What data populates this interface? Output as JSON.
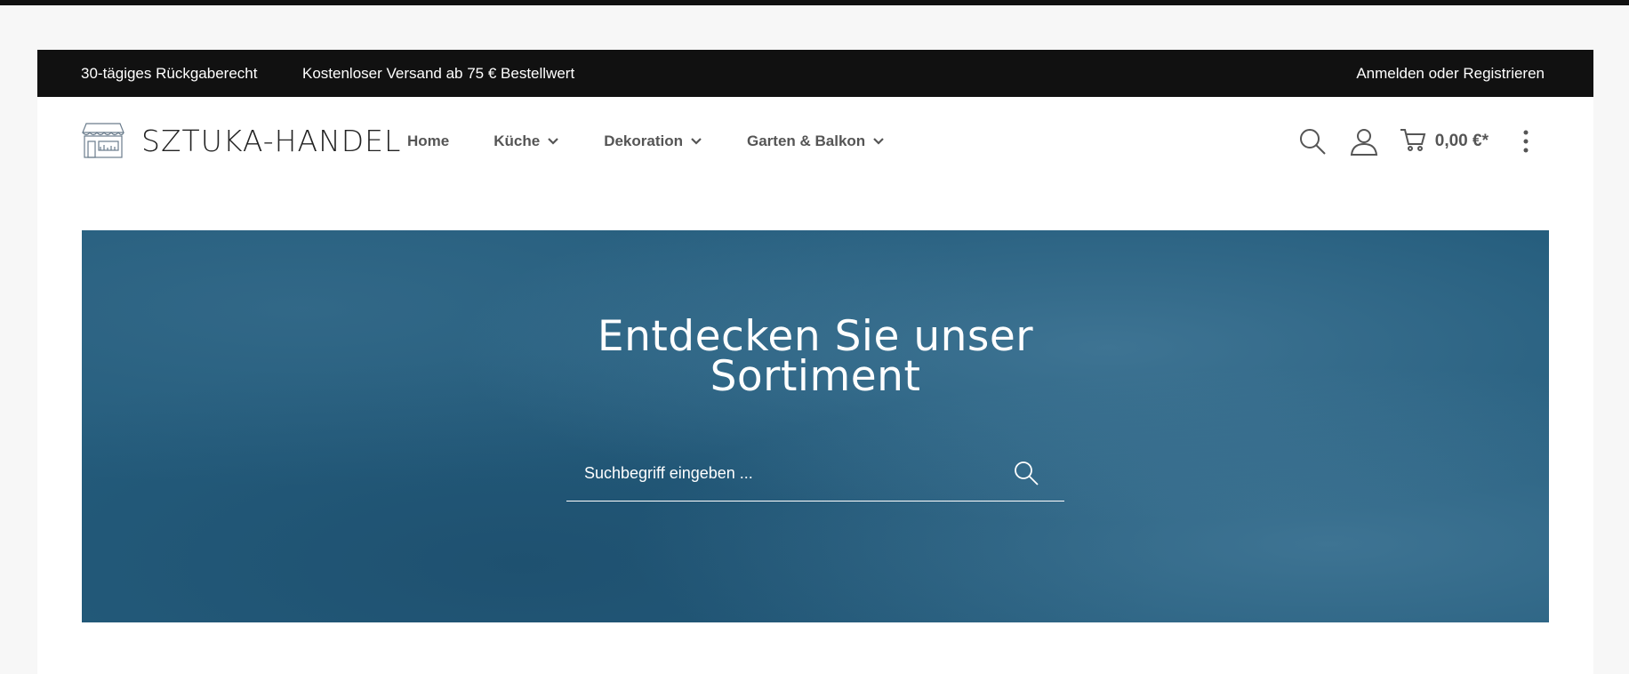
{
  "topbar": {
    "return_policy": "30-tägiges Rückgaberecht",
    "shipping": "Kostenloser Versand ab 75 € Bestellwert",
    "login": "Anmelden oder Registrieren"
  },
  "header": {
    "logo_text": "SZTUKA-HANDEL",
    "logo_icon": "shop-front-icon",
    "nav": [
      {
        "label": "Home",
        "has_dropdown": false
      },
      {
        "label": "Küche",
        "has_dropdown": true
      },
      {
        "label": "Dekoration",
        "has_dropdown": true
      },
      {
        "label": "Garten & Balkon",
        "has_dropdown": true
      }
    ],
    "actions": {
      "search_icon": "search-icon",
      "account_icon": "user-icon",
      "cart_icon": "cart-icon",
      "cart_total": "0,00 €*",
      "more_icon": "more-vertical-icon"
    }
  },
  "hero": {
    "title_line1": "Entdecken Sie unser",
    "title_line2": "Sortiment",
    "search_placeholder": "Suchbegriff eingeben ...",
    "search_value": ""
  },
  "colors": {
    "topbar_bg": "#111111",
    "hero_bg": "#245c7c",
    "nav_text": "#555555",
    "page_bg": "#f7f7f7"
  }
}
